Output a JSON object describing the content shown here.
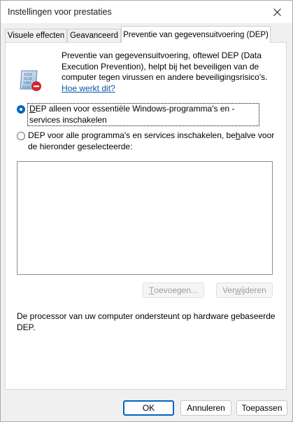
{
  "window": {
    "title": "Instellingen voor prestaties",
    "close_icon": "close-icon"
  },
  "tabs": [
    {
      "label": "Visuele effecten",
      "active": false
    },
    {
      "label": "Geavanceerd",
      "active": false
    },
    {
      "label": "Preventie van gegevensuitvoering (DEP)",
      "active": true
    }
  ],
  "dep": {
    "icon": "dep-shield-binary-icon",
    "intro_text": "Preventie van gegevensuitvoering, oftewel DEP (Data Execution Prevention), helpt bij het beveiligen van de computer tegen virussen en andere beveiligingsrisico's.",
    "help_link": "Hoe werkt dit?",
    "option_essential": {
      "accel": "D",
      "rest": "EP alleen voor essentiële Windows-programma's en -services inschakelen",
      "checked": true
    },
    "option_all": {
      "before": "DEP voor alle programma's en services inschakelen, be",
      "accel": "h",
      "after": "alve voor de hieronder geselecteerde:",
      "checked": false
    },
    "list_items": [],
    "add_button": {
      "before": "",
      "accel": "T",
      "after": "oevoegen...",
      "disabled": true
    },
    "remove_button": {
      "before": "Ver",
      "accel": "w",
      "after": "ijderen",
      "disabled": true
    },
    "processor_info": "De processor van uw computer ondersteunt op hardware gebaseerde DEP."
  },
  "footer": {
    "ok_label": "OK",
    "cancel_label": "Annuleren",
    "apply_label": "Toepassen"
  },
  "colors": {
    "accent": "#0067c0",
    "link": "#0b57a7",
    "disabled_text": "#9d9d9d"
  }
}
